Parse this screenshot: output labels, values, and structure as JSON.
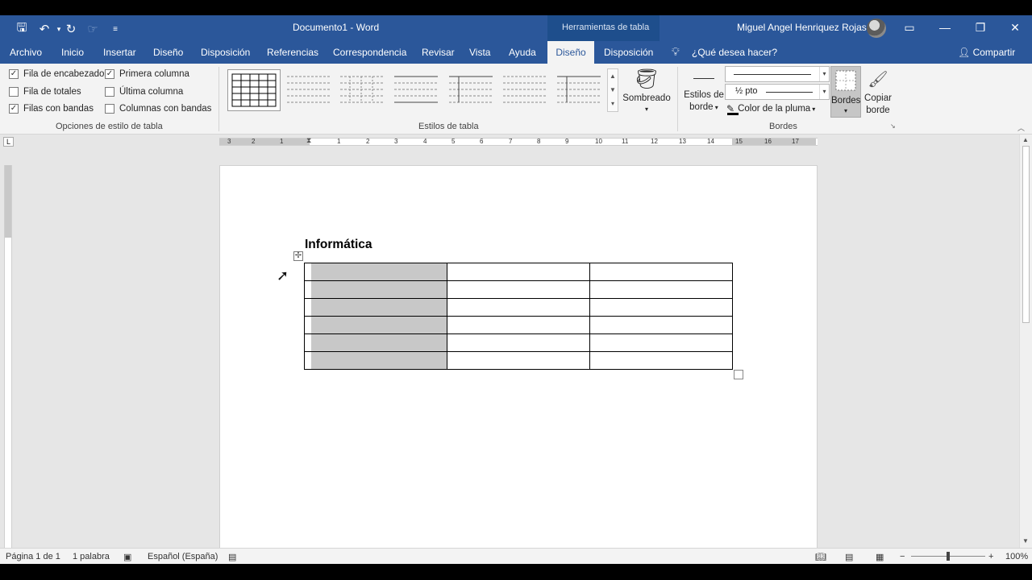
{
  "title_bar": {
    "document_title": "Documento1  -  Word",
    "contextual_label": "Herramientas de tabla",
    "user_name": "Miguel Angel Henriquez Rojas"
  },
  "tabs": [
    {
      "label": "Archivo"
    },
    {
      "label": "Inicio"
    },
    {
      "label": "Insertar"
    },
    {
      "label": "Diseño"
    },
    {
      "label": "Disposición"
    },
    {
      "label": "Referencias"
    },
    {
      "label": "Correspondencia"
    },
    {
      "label": "Revisar"
    },
    {
      "label": "Vista"
    },
    {
      "label": "Ayuda"
    },
    {
      "label": "Diseño",
      "active": true
    },
    {
      "label": "Disposición"
    }
  ],
  "tell_me": "¿Qué desea hacer?",
  "share": "Compartir",
  "table_style_options": {
    "group_label": "Opciones de estilo de tabla",
    "options": [
      {
        "label": "Fila de encabezado",
        "checked": true
      },
      {
        "label": "Fila de totales",
        "checked": false
      },
      {
        "label": "Filas con bandas",
        "checked": true
      },
      {
        "label": "Primera columna",
        "checked": true
      },
      {
        "label": "Última columna",
        "checked": false
      },
      {
        "label": "Columnas con bandas",
        "checked": false
      }
    ]
  },
  "table_styles": {
    "group_label": "Estilos de tabla",
    "shading_label": "Sombreado"
  },
  "borders": {
    "group_label": "Bordes",
    "border_styles_label_1": "Estilos de",
    "border_styles_label_2": "borde",
    "pen_weight": "½ pto",
    "pen_color_label": "Color de la pluma",
    "borders_label": "Bordes",
    "border_painter_1": "Copiar",
    "border_painter_2": "borde"
  },
  "document": {
    "heading": "Informática",
    "table": {
      "rows": 6,
      "columns": 3,
      "first_column_shaded": true
    }
  },
  "ruler": {
    "marks": [
      "3",
      "2",
      "1",
      "1",
      "2",
      "3",
      "4",
      "5",
      "6",
      "7",
      "8",
      "9",
      "10",
      "11",
      "12",
      "13",
      "14",
      "15",
      "16",
      "17"
    ]
  },
  "status_bar": {
    "page": "Página 1 de 1",
    "words": "1 palabra",
    "language": "Español (España)",
    "zoom": "100%"
  },
  "colors": {
    "word_blue": "#2b579a",
    "ribbon_bg": "#f3f3f3",
    "shading": "#c8c8c8"
  }
}
